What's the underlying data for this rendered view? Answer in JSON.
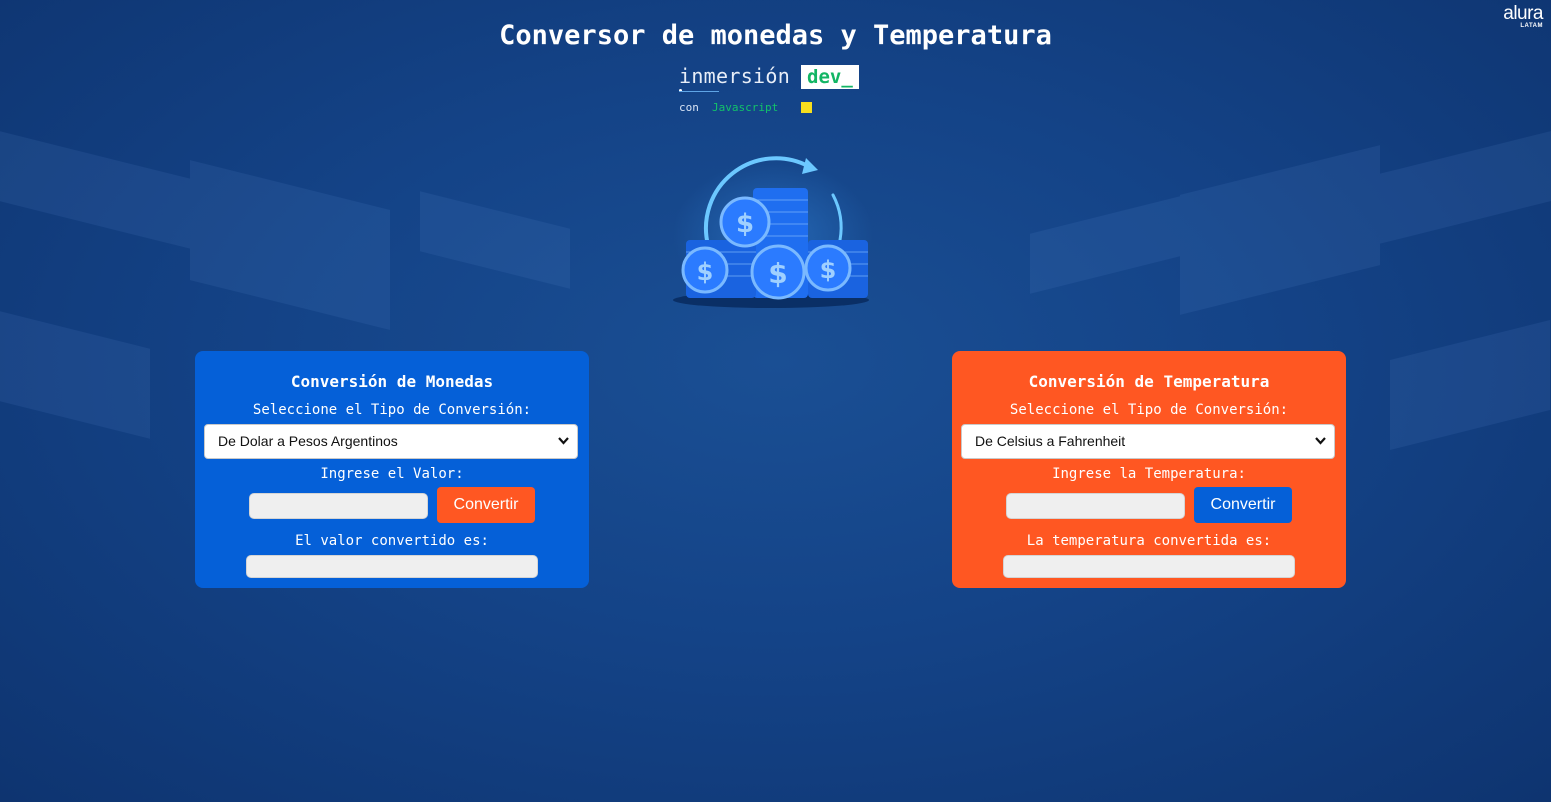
{
  "page": {
    "title": "Conversor de monedas y Temperatura"
  },
  "brand": {
    "name": "alura",
    "region": "LATAM"
  },
  "logo": {
    "word": "inmersión",
    "badge": "dev_",
    "prefix": "con",
    "language": "Javascript",
    "js_badge": "JS"
  },
  "hero": {
    "icon": "coins-exchange-icon"
  },
  "currency_panel": {
    "title": "Conversión de Monedas",
    "select_label": "Seleccione el Tipo de Conversión:",
    "selected_option": "De Dolar a Pesos Argentinos",
    "value_label": "Ingrese el Valor:",
    "value": "",
    "button_label": "Convertir",
    "result_label": "El valor convertido es:",
    "result": "",
    "color": "#0560d8"
  },
  "temperature_panel": {
    "title": "Conversión de Temperatura",
    "select_label": "Seleccione el Tipo de Conversión:",
    "selected_option": "De Celsius a Fahrenheit",
    "value_label": "Ingrese la Temperatura:",
    "value": "",
    "button_label": "Convertir",
    "result_label": "La temperatura convertida es:",
    "result": "",
    "color": "#ff5722"
  }
}
